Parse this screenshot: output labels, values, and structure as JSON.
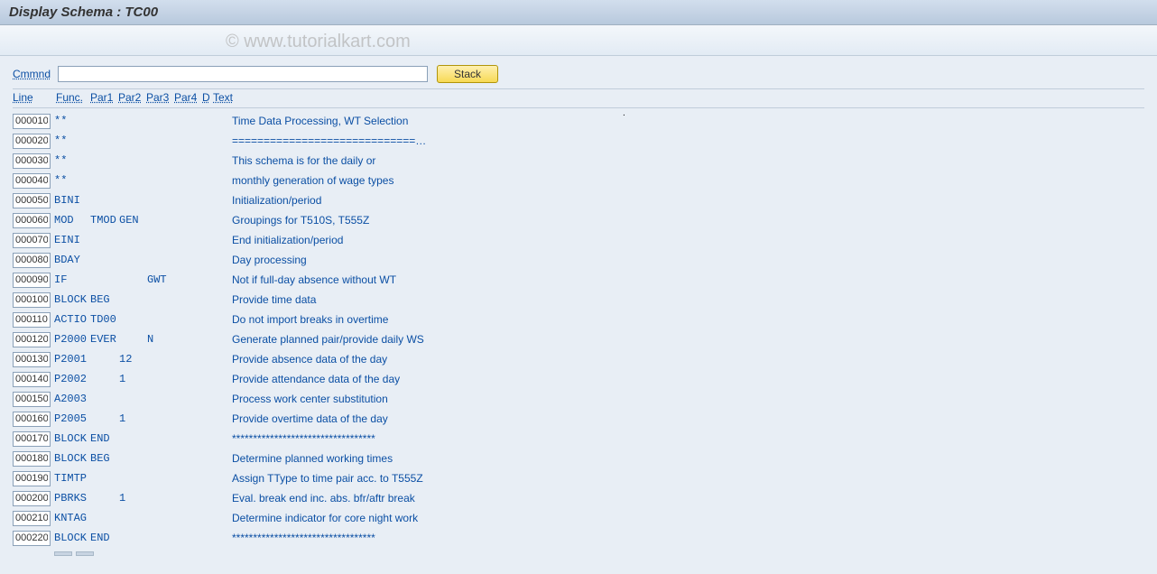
{
  "title": "Display Schema : TC00",
  "watermark": "© www.tutorialkart.com",
  "command": {
    "label": "Cmmnd",
    "value": "",
    "stack_label": "Stack"
  },
  "headers": {
    "line": "Line",
    "func": "Func.",
    "par1": "Par1",
    "par2": "Par2",
    "par3": "Par3",
    "par4": "Par4",
    "d": "D",
    "text": "Text"
  },
  "rows": [
    {
      "line": "000010",
      "func": "**",
      "par1": "",
      "par2": "",
      "par3": "",
      "par4": "",
      "d": "",
      "text": "Time Data Processing, WT Selection"
    },
    {
      "line": "000020",
      "func": "**",
      "par1": "",
      "par2": "",
      "par3": "",
      "par4": "",
      "d": "",
      "text": "=============================…"
    },
    {
      "line": "000030",
      "func": "**",
      "par1": "",
      "par2": "",
      "par3": "",
      "par4": "",
      "d": "",
      "text": "This schema is for the daily or"
    },
    {
      "line": "000040",
      "func": "**",
      "par1": "",
      "par2": "",
      "par3": "",
      "par4": "",
      "d": "",
      "text": "monthly generation of wage types"
    },
    {
      "line": "000050",
      "func": "BINI",
      "par1": "",
      "par2": "",
      "par3": "",
      "par4": "",
      "d": "",
      "text": "Initialization/period"
    },
    {
      "line": "000060",
      "func": "MOD",
      "par1": "TMOD",
      "par2": "GEN",
      "par3": "",
      "par4": "",
      "d": "",
      "text": "Groupings for T510S, T555Z"
    },
    {
      "line": "000070",
      "func": "EINI",
      "par1": "",
      "par2": "",
      "par3": "",
      "par4": "",
      "d": "",
      "text": "End initialization/period"
    },
    {
      "line": "000080",
      "func": "BDAY",
      "par1": "",
      "par2": "",
      "par3": "",
      "par4": "",
      "d": "",
      "text": "Day processing"
    },
    {
      "line": "000090",
      "func": "IF",
      "par1": "",
      "par2": "",
      "par3": "GWT",
      "par4": "",
      "d": "",
      "text": "Not if full-day absence without WT"
    },
    {
      "line": "000100",
      "func": "BLOCK",
      "par1": "BEG",
      "par2": "",
      "par3": "",
      "par4": "",
      "d": "",
      "text": "Provide time data"
    },
    {
      "line": "000110",
      "func": "ACTIO",
      "par1": "TD00",
      "par2": "",
      "par3": "",
      "par4": "",
      "d": "",
      "text": "Do not import breaks in overtime"
    },
    {
      "line": "000120",
      "func": "P2000",
      "par1": "EVER",
      "par2": "",
      "par3": "N",
      "par4": "",
      "d": "",
      "text": "Generate planned pair/provide daily WS"
    },
    {
      "line": "000130",
      "func": "P2001",
      "par1": "",
      "par2": "12",
      "par3": "",
      "par4": "",
      "d": "",
      "text": "Provide absence data of the day"
    },
    {
      "line": "000140",
      "func": "P2002",
      "par1": "",
      "par2": "1",
      "par3": "",
      "par4": "",
      "d": "",
      "text": "Provide attendance data of the day"
    },
    {
      "line": "000150",
      "func": "A2003",
      "par1": "",
      "par2": "",
      "par3": "",
      "par4": "",
      "d": "",
      "text": "Process work center substitution"
    },
    {
      "line": "000160",
      "func": "P2005",
      "par1": "",
      "par2": "1",
      "par3": "",
      "par4": "",
      "d": "",
      "text": "Provide overtime data of the day"
    },
    {
      "line": "000170",
      "func": "BLOCK",
      "par1": "END",
      "par2": "",
      "par3": "",
      "par4": "",
      "d": "",
      "text": "**********************************"
    },
    {
      "line": "000180",
      "func": "BLOCK",
      "par1": "BEG",
      "par2": "",
      "par3": "",
      "par4": "",
      "d": "",
      "text": "Determine planned working times"
    },
    {
      "line": "000190",
      "func": "TIMTP",
      "par1": "",
      "par2": "",
      "par3": "",
      "par4": "",
      "d": "",
      "text": "Assign TType to time pair acc. to T555Z"
    },
    {
      "line": "000200",
      "func": "PBRKS",
      "par1": "",
      "par2": "1",
      "par3": "",
      "par4": "",
      "d": "",
      "text": "Eval. break end inc. abs. bfr/aftr break"
    },
    {
      "line": "000210",
      "func": "KNTAG",
      "par1": "",
      "par2": "",
      "par3": "",
      "par4": "",
      "d": "",
      "text": "Determine indicator for core night work"
    },
    {
      "line": "000220",
      "func": "BLOCK",
      "par1": "END",
      "par2": "",
      "par3": "",
      "par4": "",
      "d": "",
      "text": "**********************************"
    }
  ]
}
